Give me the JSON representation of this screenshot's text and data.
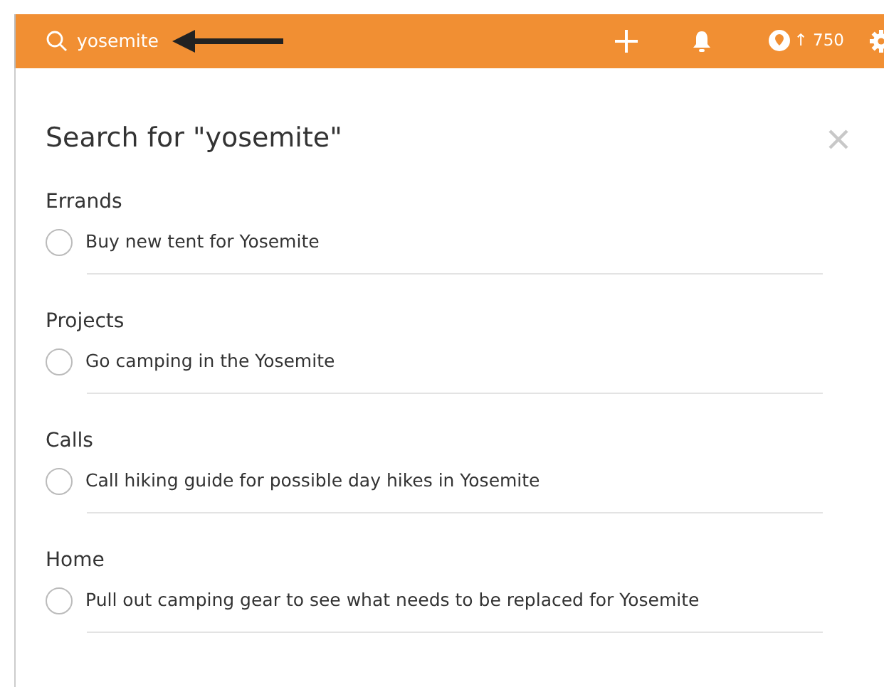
{
  "topbar": {
    "search": {
      "value": "yosemite"
    },
    "points": "↑ 750"
  },
  "results": {
    "title": "Search for \"yosemite\"",
    "groups": [
      {
        "heading": "Errands",
        "tasks": [
          {
            "text": "Buy new tent for Yosemite",
            "checked": false
          }
        ]
      },
      {
        "heading": "Projects",
        "tasks": [
          {
            "text": "Go camping in the Yosemite",
            "checked": false
          }
        ]
      },
      {
        "heading": "Calls",
        "tasks": [
          {
            "text": "Call hiking guide for possible day hikes in Yosemite",
            "checked": false
          }
        ]
      },
      {
        "heading": "Home",
        "tasks": [
          {
            "text": "Pull out camping gear to see what needs to be replaced for Yosemite",
            "checked": false
          }
        ]
      }
    ]
  }
}
